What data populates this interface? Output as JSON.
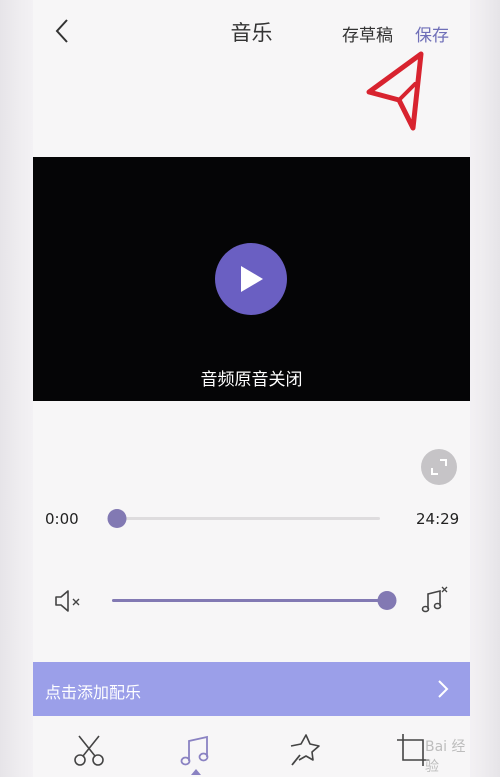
{
  "header": {
    "title": "音乐",
    "draft_label": "存草稿",
    "save_label": "保存"
  },
  "video": {
    "caption": "音频原音关闭"
  },
  "playback": {
    "current_time": "0:00",
    "duration": "24:29",
    "progress_fraction": 0.0
  },
  "volume": {
    "level_fraction": 1.0
  },
  "add_music": {
    "label": "点击添加配乐"
  },
  "tabs": [
    {
      "icon": "scissors-icon"
    },
    {
      "icon": "music-note-icon",
      "selected": true
    },
    {
      "icon": "magic-wand-icon"
    },
    {
      "icon": "crop-icon"
    }
  ],
  "watermark": {
    "text": "Bai 经验"
  },
  "colors": {
    "accent": "#8279b3",
    "save_text": "#6f6fb8",
    "play_button": "#6a5fc2",
    "add_bar": "#9b9fe9",
    "annotation_arrow": "#d8232f"
  }
}
